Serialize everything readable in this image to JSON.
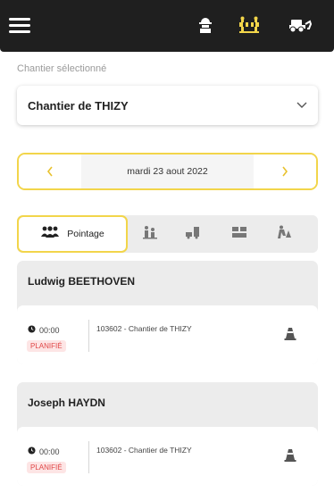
{
  "header": {
    "menu_icon": "hamburger-menu-icon",
    "icons": [
      "worker-icon",
      "construction-barrier-icon",
      "vehicle-icon"
    ],
    "active_color": "#f2d54a"
  },
  "selection": {
    "label": "Chantier sélectionné",
    "value": "Chantier de THIZY"
  },
  "date_nav": {
    "date": "mardi 23 aout 2022",
    "accent": "#f2d54a"
  },
  "tabs": {
    "active_label": "Pointage",
    "items": [
      "people-icon",
      "worker-group-icon",
      "machine-icon",
      "container-icon",
      "roadwork-icon"
    ]
  },
  "persons": [
    {
      "name": "Ludwig BEETHOVEN",
      "time": "00:00",
      "status": "PLANIFIÉ",
      "site": "103602 - Chantier de THIZY"
    },
    {
      "name": "Joseph HAYDN",
      "time": "00:00",
      "status": "PLANIFIÉ",
      "site": "103602 - Chantier de THIZY"
    }
  ]
}
